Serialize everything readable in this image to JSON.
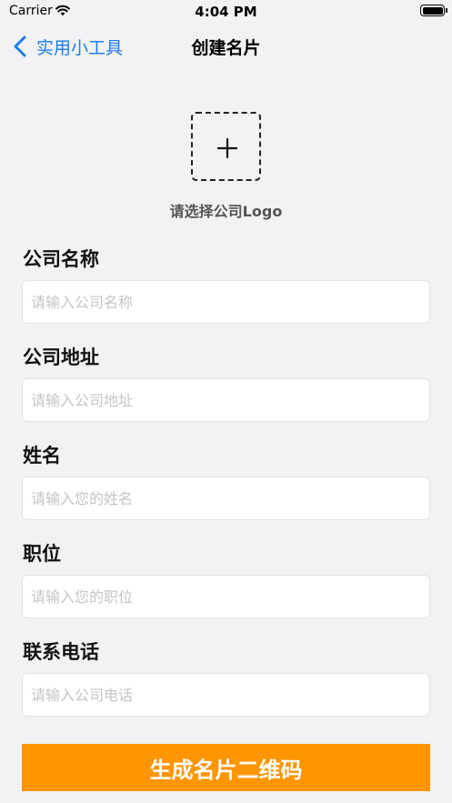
{
  "status_bar": {
    "carrier": "Carrier",
    "time": "4:04 PM"
  },
  "nav": {
    "back_label": "实用小工具",
    "title": "创建名片"
  },
  "logo": {
    "caption": "请选择公司Logo"
  },
  "form": {
    "fields": [
      {
        "label": "公司名称",
        "placeholder": "请输入公司名称",
        "value": ""
      },
      {
        "label": "公司地址",
        "placeholder": "请输入公司地址",
        "value": ""
      },
      {
        "label": "姓名",
        "placeholder": "请输入您的姓名",
        "value": ""
      },
      {
        "label": "职位",
        "placeholder": "请输入您的职位",
        "value": ""
      },
      {
        "label": "联系电话",
        "placeholder": "请输入公司电话",
        "value": ""
      }
    ],
    "submit_label": "生成名片二维码"
  },
  "colors": {
    "accent_blue": "#1a7cf5",
    "button_orange": "#ff9500",
    "background": "#f2f2f4"
  },
  "icons": [
    "wifi-icon",
    "battery-icon",
    "chevron-left-icon",
    "plus-icon"
  ]
}
